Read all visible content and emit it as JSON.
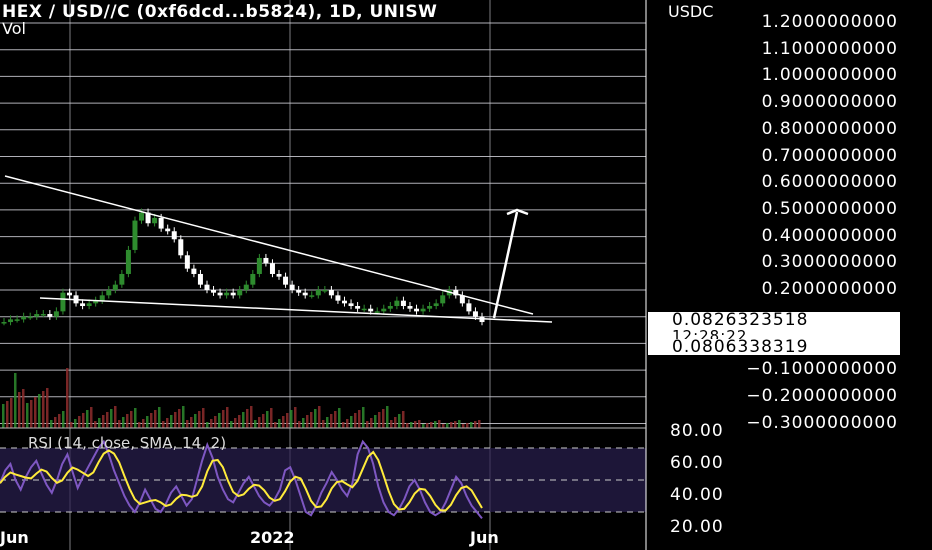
{
  "header": {
    "title": "HEX / USD//C (0xf6dcd...b5824), 1D, UNISW",
    "volume_label": "Vol",
    "currency": "USDC"
  },
  "price_axis": {
    "ticks": [
      "1.2000000000",
      "1.1000000000",
      "1.0000000000",
      "0.9000000000",
      "0.8000000000",
      "0.7000000000",
      "0.6000000000",
      "0.5000000000",
      "0.4000000000",
      "0.3000000000",
      "0.2000000000",
      "−0.1000000000",
      "−0.2000000000",
      "−0.3000000000"
    ]
  },
  "price_labels": {
    "last_price": "0.0826323518",
    "countdown": "12:28:22",
    "second_price": "0.0806338319"
  },
  "rsi": {
    "label": "RSI (14, close, SMA, 14, 2)",
    "ticks": [
      "80.00",
      "60.00",
      "40.00",
      "20.00"
    ]
  },
  "time_axis": {
    "labels": [
      "Jun",
      "2022",
      "Jun"
    ]
  },
  "colors": {
    "background": "#000000",
    "grid": "#cfcfd8",
    "up_candle": "#2e8b2e",
    "down_candle": "#ffffff",
    "trendline": "#ffffff",
    "rsi_line": "#7e57c2",
    "rsi_sma": "#ffeb3b",
    "rsi_band": "#2a2050"
  },
  "chart_data": {
    "type": "line",
    "title": "HEX / USD//C (0xf6dcd...b5824), 1D, UNISW",
    "ylabel": "USDC",
    "ylim": [
      -0.3,
      1.2
    ],
    "series": [
      {
        "name": "",
        "values": [
          0.08,
          0.09,
          0.09,
          0.1,
          0.1,
          0.11,
          0.11,
          0.1,
          0.12,
          0.19,
          0.18,
          0.15,
          0.14,
          0.15,
          0.16,
          0.18,
          0.2,
          0.22,
          0.26,
          0.35,
          0.46,
          0.49,
          0.45,
          0.47,
          0.43,
          0.42,
          0.39,
          0.33,
          0.28,
          0.26,
          0.22,
          0.2,
          0.19,
          0.18,
          0.19,
          0.18,
          0.2,
          0.22,
          0.26,
          0.32,
          0.3,
          0.26,
          0.25,
          0.22,
          0.2,
          0.19,
          0.18,
          0.18,
          0.2,
          0.2,
          0.18,
          0.16,
          0.15,
          0.14,
          0.13,
          0.13,
          0.12,
          0.12,
          0.13,
          0.14,
          0.16,
          0.14,
          0.13,
          0.12,
          0.13,
          0.14,
          0.15,
          0.18,
          0.2,
          0.18,
          0.15,
          0.12,
          0.1,
          0.08
        ]
      }
    ],
    "rsi": [
      48,
      56,
      60,
      50,
      44,
      52,
      58,
      62,
      54,
      47,
      42,
      50,
      60,
      66,
      55,
      45,
      52,
      58,
      64,
      70,
      74,
      66,
      56,
      48,
      40,
      34,
      30,
      36,
      44,
      38,
      32,
      30,
      35,
      42,
      46,
      40,
      34,
      38,
      50,
      62,
      72,
      64,
      52,
      44,
      38,
      36,
      42,
      48,
      52,
      46,
      40,
      36,
      34,
      38,
      44,
      56,
      58,
      50,
      40,
      30,
      28,
      34,
      42,
      48,
      55,
      50,
      44,
      40,
      48,
      66,
      74,
      70,
      60,
      46,
      36,
      30,
      28,
      32,
      38,
      46,
      50,
      44,
      36,
      30,
      28,
      30,
      36,
      44,
      52,
      48,
      40,
      34,
      30,
      26
    ]
  }
}
